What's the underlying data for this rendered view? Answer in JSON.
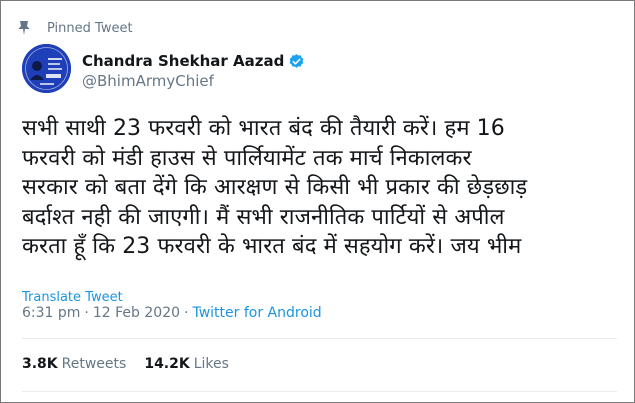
{
  "pinned": {
    "label": "Pinned Tweet"
  },
  "author": {
    "display_name": "Chandra Shekhar Aazad",
    "handle": "@BhimArmyChief",
    "verified": true
  },
  "tweet": {
    "lines": [
      "सभी साथी 23 फरवरी को भारत बंद की तैयारी करें। हम 16",
      "फरवरी को मंडी हाउस से पार्लियामेंट तक मार्च निकालकर",
      "सरकार को बता देंगे कि आरक्षण से किसी भी प्रकार की छेड़छाड़",
      "बर्दाश्त नही की जाएगी। मैं सभी राजनीतिक पार्टियों से अपील",
      "करता हूँ कि 23 फरवरी के भारत बंद में सहयोग करें। जय भीम"
    ],
    "translate_label": "Translate Tweet",
    "time": "6:31 pm",
    "date": "12 Feb 2020",
    "separator": "·",
    "source": "Twitter for Android"
  },
  "stats": {
    "retweets_count": "3.8K",
    "retweets_label": "Retweets",
    "likes_count": "14.2K",
    "likes_label": "Likes"
  },
  "icons": {
    "pin": "pin-icon",
    "verified": "verified-badge-icon",
    "avatar": "avatar"
  },
  "colors": {
    "link": "#1b95e0",
    "muted": "#657786",
    "verified": "#1da1f2"
  }
}
